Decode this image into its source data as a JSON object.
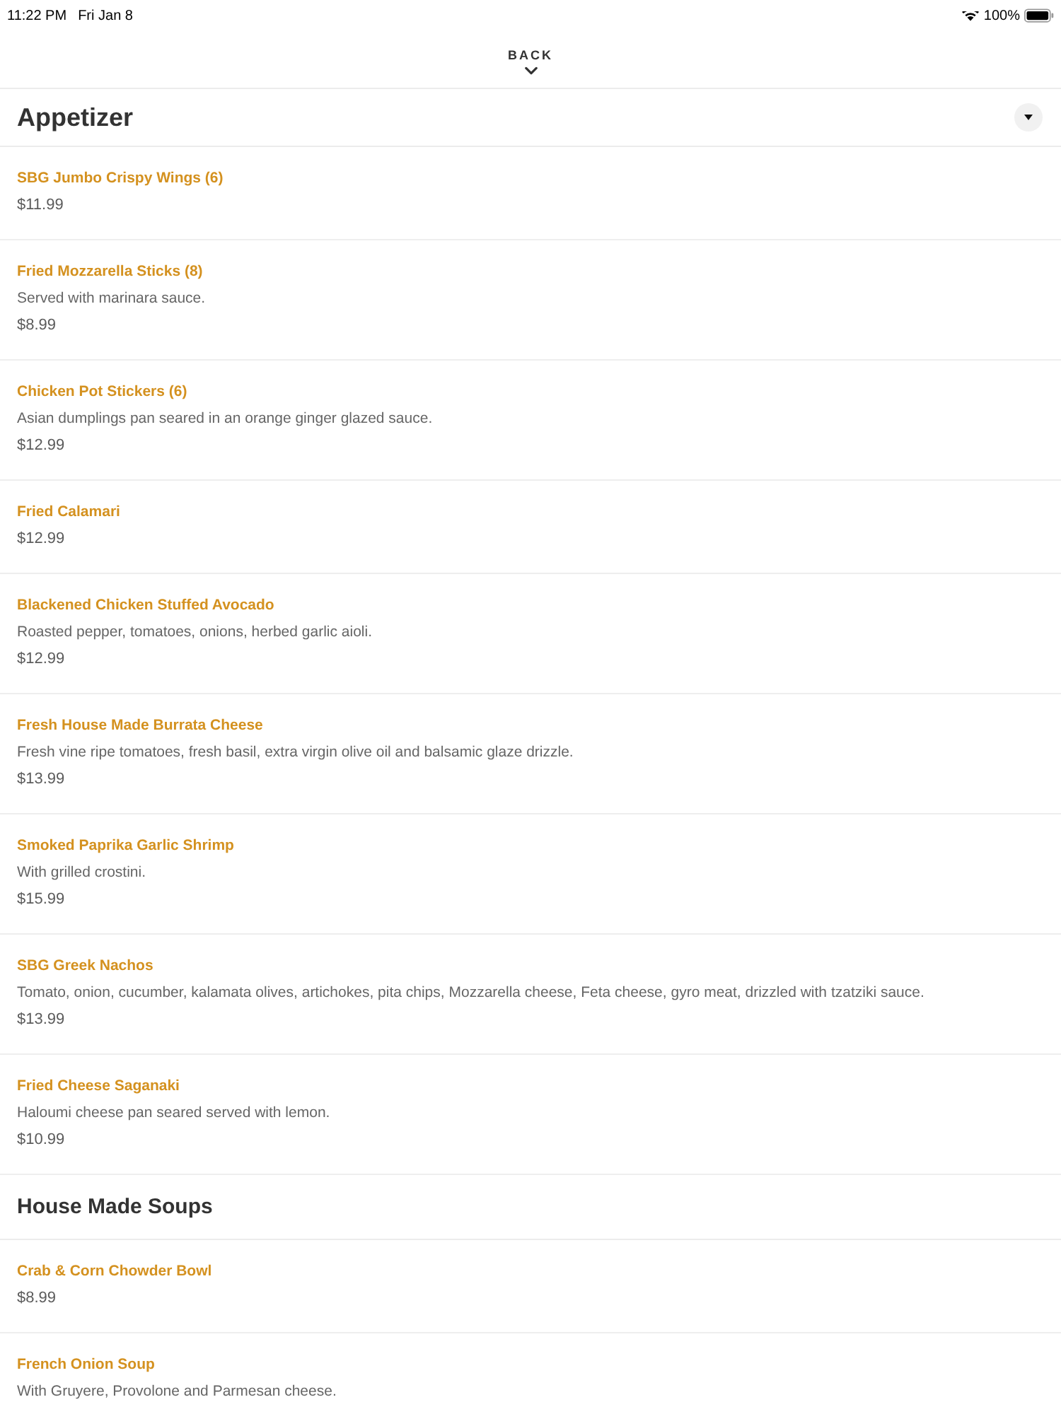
{
  "status_bar": {
    "time": "11:22 PM",
    "date": "Fri Jan 8",
    "battery": "100%"
  },
  "nav": {
    "back": "BACK"
  },
  "sections": [
    {
      "title": "Appetizer",
      "dropdown": true,
      "items": [
        {
          "name": "SBG Jumbo Crispy Wings (6)",
          "price": "$11.99"
        },
        {
          "name": "Fried Mozzarella Sticks (8)",
          "description": "Served with marinara sauce.",
          "price": "$8.99"
        },
        {
          "name": "Chicken Pot Stickers (6)",
          "description": "Asian dumplings pan seared in an orange ginger glazed sauce.",
          "price": "$12.99"
        },
        {
          "name": "Fried Calamari",
          "price": "$12.99"
        },
        {
          "name": "Blackened Chicken Stuffed Avocado",
          "description": "Roasted pepper, tomatoes, onions, herbed garlic aioli.",
          "price": "$12.99"
        },
        {
          "name": "Fresh House Made Burrata Cheese",
          "description": "Fresh vine ripe tomatoes, fresh basil, extra virgin olive oil and balsamic glaze drizzle.",
          "price": "$13.99"
        },
        {
          "name": "Smoked Paprika Garlic Shrimp",
          "description": "With grilled crostini.",
          "price": "$15.99"
        },
        {
          "name": "SBG Greek Nachos",
          "description": "Tomato, onion, cucumber, kalamata olives, artichokes, pita chips, Mozzarella cheese, Feta cheese, gyro meat, drizzled with tzatziki sauce.",
          "price": "$13.99"
        },
        {
          "name": "Fried Cheese Saganaki",
          "description": "Haloumi cheese pan seared served with lemon.",
          "price": "$10.99"
        }
      ]
    },
    {
      "title": "House Made Soups",
      "dropdown": false,
      "items": [
        {
          "name": "Crab & Corn Chowder Bowl",
          "price": "$8.99"
        },
        {
          "name": "French Onion Soup",
          "description": "With Gruyere, Provolone and Parmesan cheese."
        }
      ]
    }
  ]
}
